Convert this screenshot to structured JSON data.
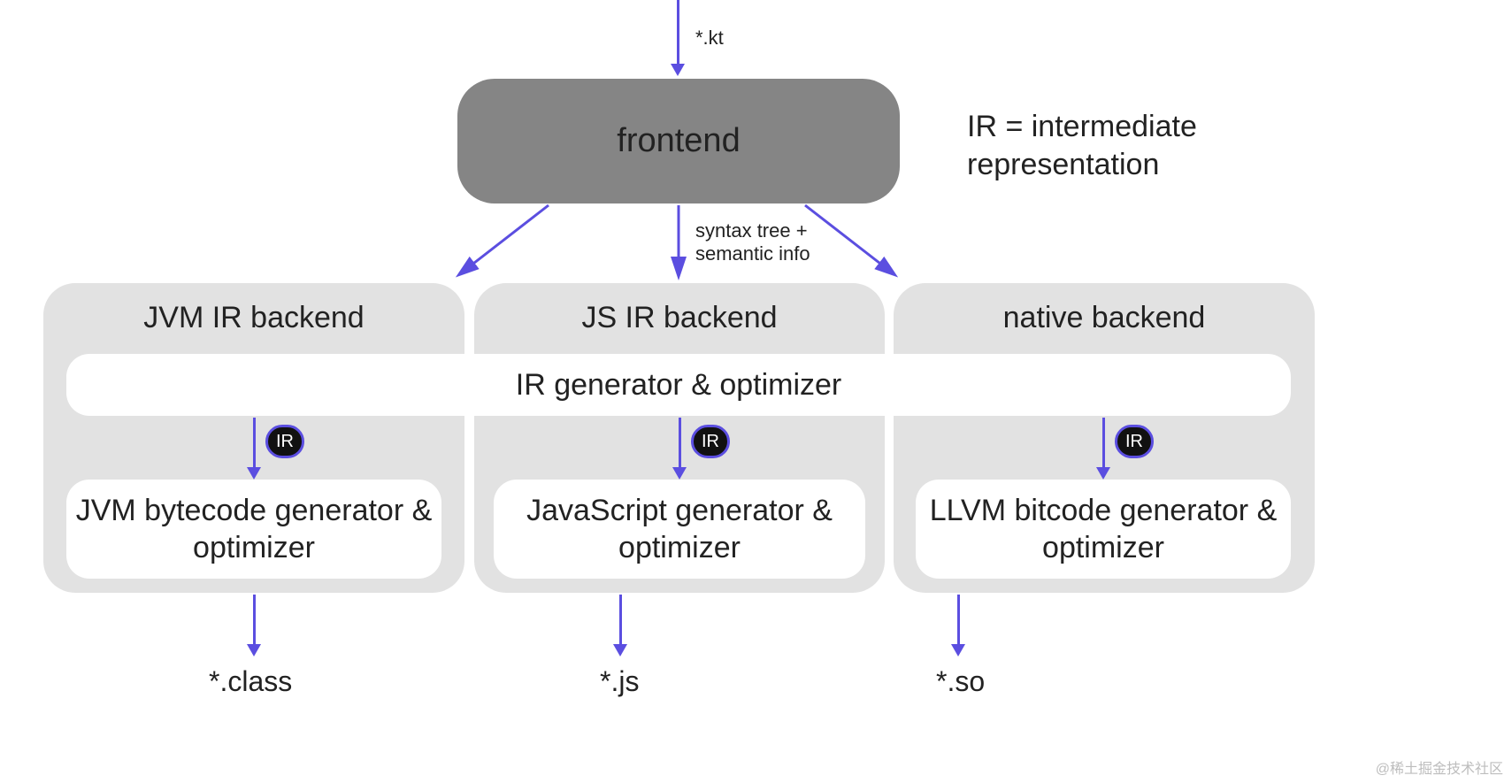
{
  "input_label": "*.kt",
  "frontend_label": "frontend",
  "ir_note_line1": "IR = intermediate",
  "ir_note_line2": "representation",
  "mid_label_line1": "syntax tree +",
  "mid_label_line2": "semantic info",
  "ir_generator_label": "IR generator & optimizer",
  "ir_badge_text": "IR",
  "backends": {
    "jvm": {
      "title": "JVM IR backend",
      "inner": "JVM bytecode generator &  optimizer",
      "output": "*.class"
    },
    "js": {
      "title": "JS IR backend",
      "inner": "JavaScript generator & optimizer",
      "output": "*.js"
    },
    "native": {
      "title": "native backend",
      "inner": "LLVM bitcode generator &  optimizer",
      "output": "*.so"
    }
  },
  "watermark": "@稀土掘金技术社区",
  "colors": {
    "arrow": "#5b4ee0",
    "gray_box": "#e2e2e2",
    "dark_box": "#858585",
    "badge_bg": "#111111"
  }
}
